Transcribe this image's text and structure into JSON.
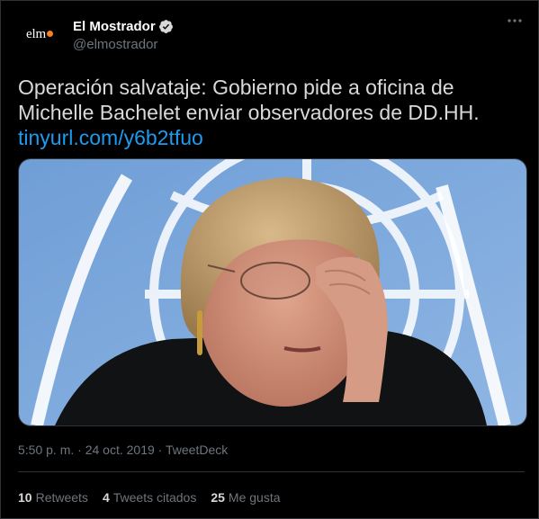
{
  "colors": {
    "background": "#000000",
    "text": "#d9d9d9",
    "muted": "#6e767d",
    "link": "#1d9bf0",
    "verified": "#d9d9d9",
    "avatar_dot": "#f5821f"
  },
  "author": {
    "avatar_text": "elm",
    "display_name": "El Mostrador",
    "handle": "@elmostrador",
    "verified_icon": "verified-badge-icon"
  },
  "more_icon": "more-options-icon",
  "tweet": {
    "text": "Operación salvataje: Gobierno pide a oficina de Michelle Bachelet enviar observadores de DD.HH.",
    "link": "tinyurl.com/y6b2tfuo"
  },
  "media": {
    "icon": "photo-image"
  },
  "meta": {
    "time": "5:50 p. m.",
    "separator": "·",
    "date": "24 oct. 2019",
    "source": "TweetDeck"
  },
  "stats": {
    "retweets_count": "10",
    "retweets_label": "Retweets",
    "quotes_count": "4",
    "quotes_label": "Tweets citados",
    "likes_count": "25",
    "likes_label": "Me gusta"
  }
}
